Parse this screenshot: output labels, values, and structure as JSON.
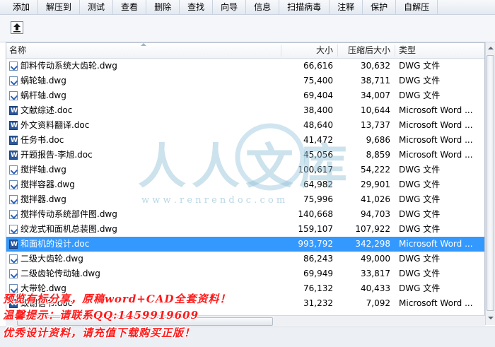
{
  "toolbar": {
    "items": [
      "添加",
      "解压到",
      "测试",
      "查看",
      "删除",
      "查找",
      "向导",
      "信息",
      "扫描病毒",
      "注释",
      "保护",
      "自解压"
    ]
  },
  "columns": {
    "name": "名称",
    "size": "大小",
    "compressed": "压缩后大小",
    "type": "类型"
  },
  "files": [
    {
      "name": "卸料传动系统大齿轮.dwg",
      "size": "66,616",
      "compressed": "30,632",
      "type": "DWG 文件",
      "kind": "dwg"
    },
    {
      "name": "蜗轮轴.dwg",
      "size": "75,400",
      "compressed": "38,711",
      "type": "DWG 文件",
      "kind": "dwg"
    },
    {
      "name": "蜗杆轴.dwg",
      "size": "69,404",
      "compressed": "34,007",
      "type": "DWG 文件",
      "kind": "dwg"
    },
    {
      "name": "文献综述.doc",
      "size": "38,400",
      "compressed": "10,644",
      "type": "Microsoft Word ...",
      "kind": "doc"
    },
    {
      "name": "外文资料翻译.doc",
      "size": "48,640",
      "compressed": "13,737",
      "type": "Microsoft Word ...",
      "kind": "doc"
    },
    {
      "name": "任务书.doc",
      "size": "41,472",
      "compressed": "9,686",
      "type": "Microsoft Word ...",
      "kind": "doc"
    },
    {
      "name": "开题报告-李旭.doc",
      "size": "45,056",
      "compressed": "8,859",
      "type": "Microsoft Word ...",
      "kind": "doc"
    },
    {
      "name": "搅拌轴.dwg",
      "size": "100,617",
      "compressed": "54,222",
      "type": "DWG 文件",
      "kind": "dwg"
    },
    {
      "name": "搅拌容器.dwg",
      "size": "64,982",
      "compressed": "29,901",
      "type": "DWG 文件",
      "kind": "dwg"
    },
    {
      "name": "搅拌器.dwg",
      "size": "75,996",
      "compressed": "41,026",
      "type": "DWG 文件",
      "kind": "dwg"
    },
    {
      "name": "搅拌传动系统部件图.dwg",
      "size": "140,668",
      "compressed": "94,703",
      "type": "DWG 文件",
      "kind": "dwg"
    },
    {
      "name": "绞龙式和面机总装图.dwg",
      "size": "159,107",
      "compressed": "107,922",
      "type": "DWG 文件",
      "kind": "dwg"
    },
    {
      "name": "和面机的设计.doc",
      "size": "993,792",
      "compressed": "342,298",
      "type": "Microsoft Word ...",
      "kind": "doc",
      "selected": true
    },
    {
      "name": "二级大齿轮.dwg",
      "size": "86,243",
      "compressed": "49,000",
      "type": "DWG 文件",
      "kind": "dwg"
    },
    {
      "name": "二级齿轮传动轴.dwg",
      "size": "69,949",
      "compressed": "33,817",
      "type": "DWG 文件",
      "kind": "dwg"
    },
    {
      "name": "大带轮.dwg",
      "size": "76,132",
      "compressed": "40,433",
      "type": "DWG 文件",
      "kind": "dwg"
    },
    {
      "name": "致谢信书.doc",
      "size": "31,232",
      "compressed": "7,092",
      "type": "Microsoft Word ...",
      "kind": "doc"
    }
  ],
  "watermark": {
    "logo_text": "人人文库",
    "url": "w w w . r e n r e n d o c . c o m"
  },
  "overlay": {
    "line1": "预览有标分享，原稿word+CAD全套资料！",
    "line2": "温馨提示：请联系QQ:1459919609",
    "line3": "优秀设计资料，请充值下载购买正版！"
  },
  "colors": {
    "selection": "#3399ff",
    "overlay_red": "#ff1a1a",
    "watermark_blue": "#8fbfd6"
  }
}
